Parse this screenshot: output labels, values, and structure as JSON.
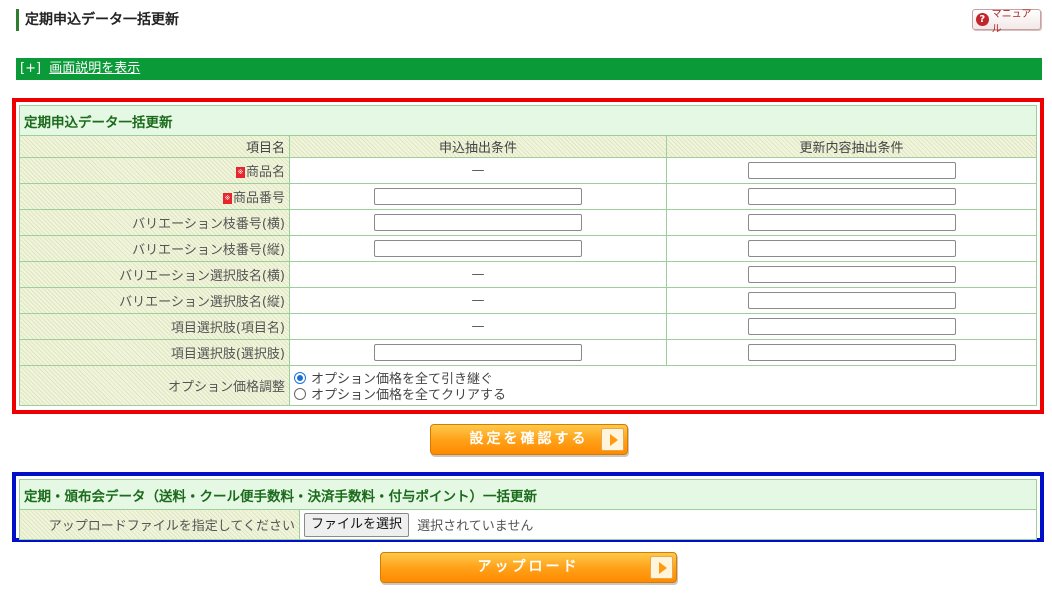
{
  "page": {
    "title": "定期申込データ一括更新",
    "manual_label": "マニュアル"
  },
  "help_bar": {
    "toggle": "[+]",
    "link": "画面説明を表示"
  },
  "bulk_update": {
    "heading": "定期申込データ一括更新",
    "columns": [
      "項目名",
      "申込抽出条件",
      "更新内容抽出条件"
    ],
    "required_mark": "※",
    "dash": "—",
    "rows": {
      "product_name": "商品名",
      "product_number": "商品番号",
      "variation_branch_h": "バリエーション枝番号(横)",
      "variation_branch_v": "バリエーション枝番号(縦)",
      "variation_choice_h": "バリエーション選択肢名(横)",
      "variation_choice_v": "バリエーション選択肢名(縦)",
      "item_choice_name": "項目選択肢(項目名)",
      "item_choice_value": "項目選択肢(選択肢)",
      "option_price": "オプション価格調整"
    },
    "option_price_choices": [
      "オプション価格を全て引き継ぐ",
      "オプション価格を全てクリアする"
    ],
    "option_price_selected": "オプション価格を全て引き継ぐ",
    "confirm_button": "設定を確認する"
  },
  "upload": {
    "heading": "定期・頒布会データ（送料・クール便手数料・決済手数料・付与ポイント）一括更新",
    "label": "アップロードファイルを指定してください",
    "file_button": "ファイルを選択",
    "file_status": "選択されていません",
    "upload_button": "アップロード"
  },
  "colors": {
    "green_bar": "#0a9a37",
    "red_frame": "#ee0000",
    "blue_frame": "#0010c8",
    "button_orange": "#ffa21a"
  }
}
